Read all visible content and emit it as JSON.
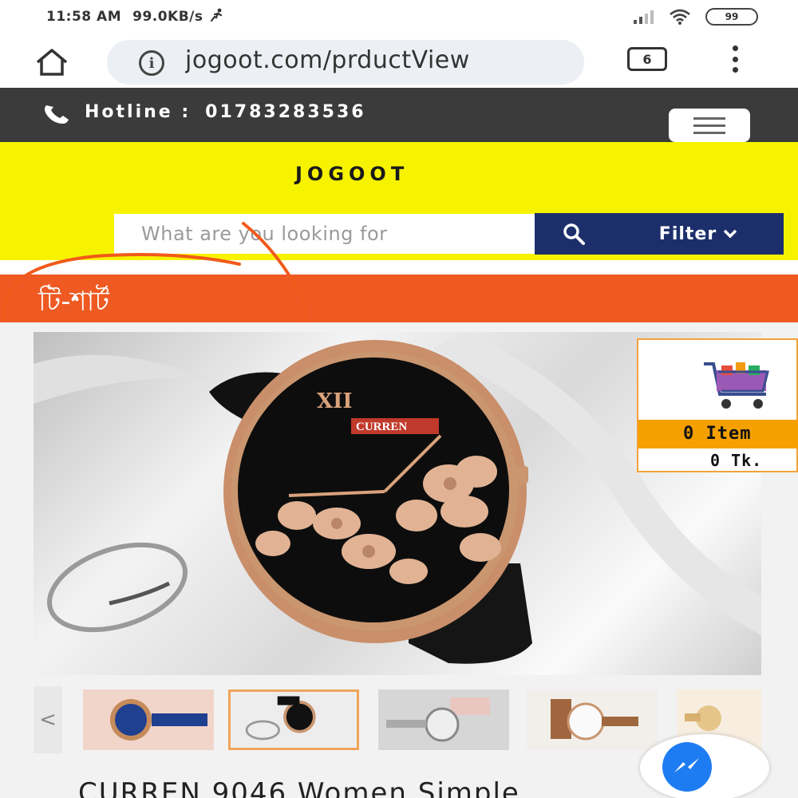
{
  "status_bar": {
    "time": "11:58 AM",
    "speed": "99.0KB/s",
    "battery": "99"
  },
  "browser": {
    "url": "jogoot.com/prductView",
    "tab_count": "6",
    "icons": [
      "home-icon",
      "info-icon",
      "tabs-icon",
      "kebab-menu-icon"
    ]
  },
  "hotline": {
    "label": "Hotline :",
    "number": "01783283536"
  },
  "header": {
    "logo": "JOGOOT",
    "search_placeholder": "What are you looking for",
    "filter_label": "Filter"
  },
  "category": {
    "title": "টি-শার্ট"
  },
  "cart": {
    "items": "0 Item",
    "total": "0 Tk."
  },
  "product": {
    "title": "CURREN 9046 Women Simple",
    "thumb_prev": "<"
  },
  "colors": {
    "header_yellow": "#f7f300",
    "hotline_bg": "#3b3b3b",
    "category_orange": "#ee5a22",
    "search_navy": "#1d2f6b",
    "cart_orange": "#f5a000",
    "messenger_blue": "#1e7cf2"
  }
}
